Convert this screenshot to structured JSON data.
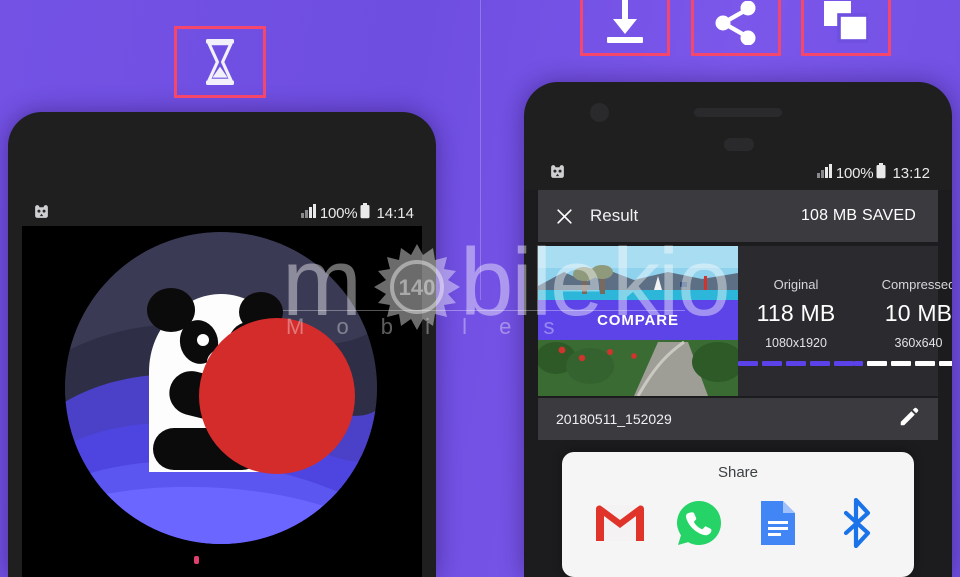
{
  "page": {
    "background_color": "#6e4fe0",
    "accent_color": "#5b41e8",
    "annotation_color": "#f4476b"
  },
  "annotations": [
    {
      "name": "hourglass",
      "icon": "hourglass-icon",
      "label": "Hourglass"
    },
    {
      "name": "download",
      "icon": "download-icon",
      "label": "Download"
    },
    {
      "name": "share",
      "icon": "share-icon",
      "label": "Share"
    },
    {
      "name": "batch",
      "icon": "copy-layers-icon",
      "label": "Batch"
    }
  ],
  "left_phone": {
    "statusbar": {
      "app_icon": "panda-app-icon",
      "signal_icon": "signal-bars-icon",
      "battery_percent": "100%",
      "battery_icon": "battery-full-icon",
      "time": "14:14"
    },
    "splash": {
      "illustration": "panda-splash-illustration",
      "boot_indicator": "boot-dot"
    }
  },
  "right_phone": {
    "statusbar": {
      "app_icon": "panda-app-icon",
      "signal_icon": "signal-bars-icon",
      "battery_percent": "100%",
      "battery_icon": "battery-full-icon",
      "time": "13:12"
    },
    "result_bar": {
      "close_icon": "close-icon",
      "title": "Result",
      "saved_text": "108 MB SAVED"
    },
    "compare_card": {
      "thumbnail": "beach-photo-thumbnail",
      "compare_button": "COMPARE",
      "original": {
        "label": "Original",
        "size": "118 MB",
        "dimensions": "1080x1920",
        "filled_segments": 5,
        "empty_segments": 0
      },
      "compressed": {
        "label": "Compressed",
        "size": "10 MB",
        "dimensions": "360x640",
        "filled_segments": 1,
        "empty_segments": 5
      }
    },
    "file_row": {
      "filename": "20180511_152029",
      "edit_icon": "pencil-edit-icon"
    },
    "share_sheet": {
      "title": "Share",
      "apps": [
        {
          "name": "gmail",
          "icon": "gmail-icon",
          "color": "#EA4335"
        },
        {
          "name": "whatsapp",
          "icon": "whatsapp-icon",
          "color": "#25D366"
        },
        {
          "name": "google-docs",
          "icon": "google-docs-icon",
          "color": "#4285F4"
        },
        {
          "name": "bluetooth",
          "icon": "bluetooth-icon",
          "color": "#1A73E8"
        }
      ]
    }
  },
  "watermark": {
    "main_text_left": "m",
    "main_text_right": "bile",
    "main_text_tail": "kio",
    "badge_text": "140",
    "subtitle": "M o b i l e s"
  }
}
